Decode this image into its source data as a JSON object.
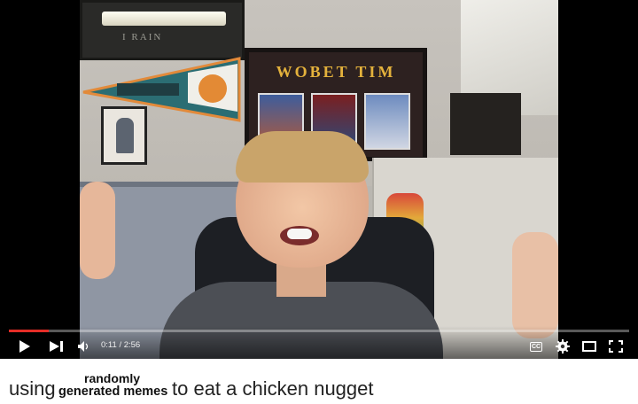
{
  "player": {
    "frame_sign": "I RAIN",
    "poster_title": "WOBET TIM",
    "progress_fraction": 0.064,
    "current_time": "0:11",
    "separator": "/",
    "duration": "2:56",
    "cc_label": "CC",
    "icons": {
      "play": "play-icon",
      "next": "next-icon",
      "volume": "volume-icon",
      "captions": "captions-icon",
      "settings": "gear-icon",
      "theater": "theater-mode-icon",
      "fullscreen": "fullscreen-icon"
    },
    "accent_color": "#e52d27"
  },
  "caption": {
    "part1": "using",
    "stack_top": "randomly",
    "stack_bottom": "generated memes",
    "part2": "to eat a chicken nugget"
  }
}
